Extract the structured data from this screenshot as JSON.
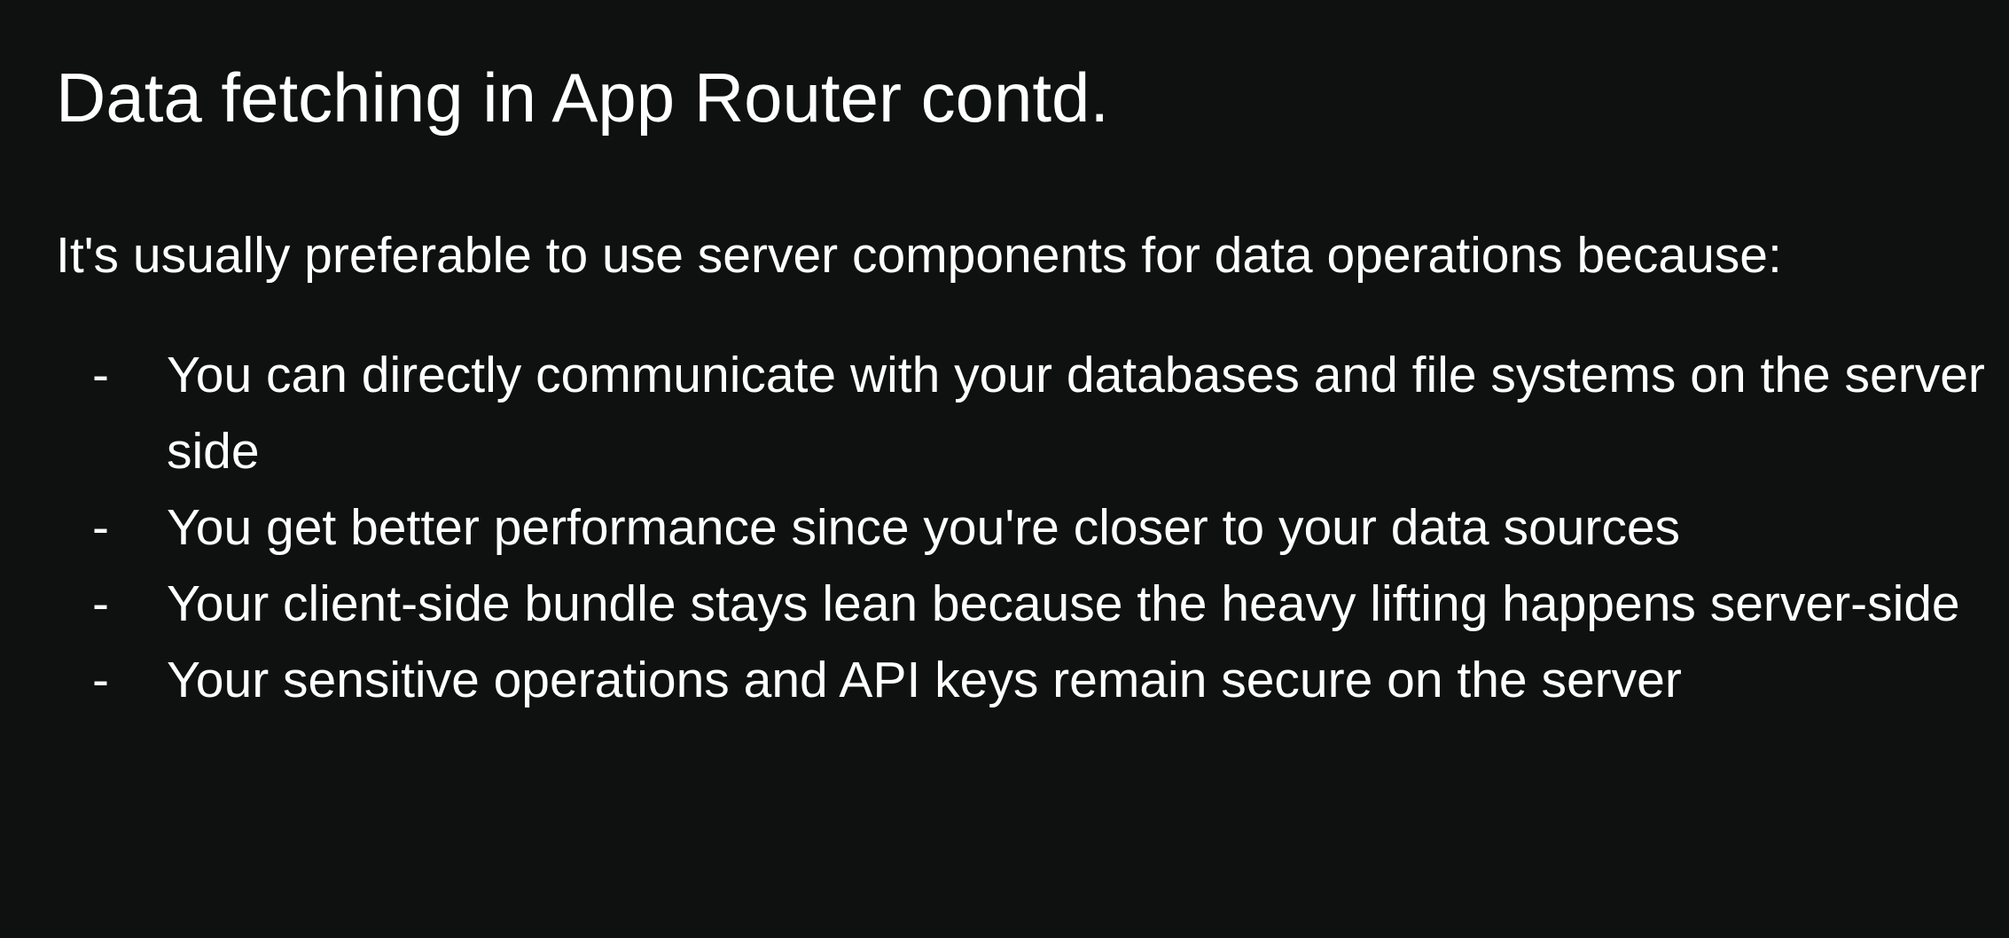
{
  "slide": {
    "title": "Data fetching in App Router contd.",
    "intro": "It's usually preferable to use server components for data operations because:",
    "bullet_marker": "-",
    "bullets": [
      "You can directly communicate with your databases and file systems on the server side",
      "You get better performance since you're closer to your data sources",
      "Your client-side bundle stays lean because the heavy lifting happens server-side",
      "Your sensitive operations and API keys remain secure on the server"
    ]
  },
  "colors": {
    "background": "#0f1110",
    "text": "#ffffff"
  }
}
